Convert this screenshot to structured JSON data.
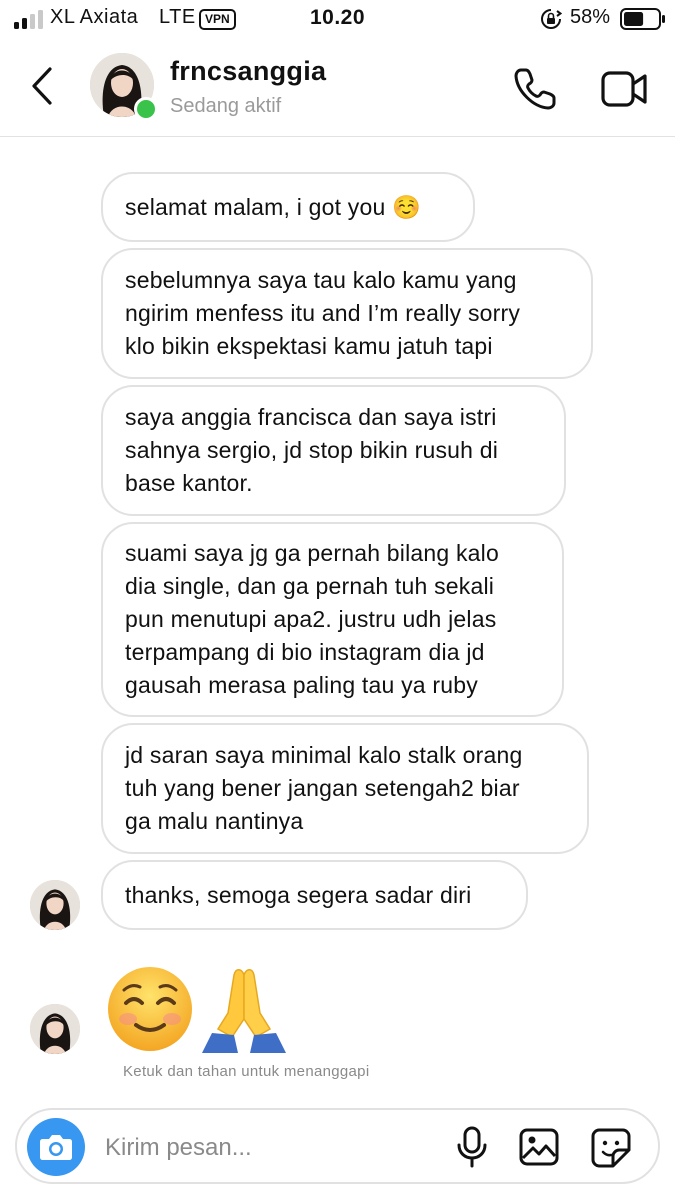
{
  "status_bar": {
    "carrier": "XL Axiata",
    "network": "LTE",
    "vpn": "VPN",
    "time": "10.20",
    "battery": "58%",
    "battery_level": 0.58,
    "signal_bars_filled": 2,
    "signal_bars_total": 4
  },
  "header": {
    "username": "frncsanggia",
    "activity": "Sedang aktif",
    "online_color": "#3ac34a",
    "icons": [
      "back-chevron-icon",
      "phone-icon",
      "video-camera-icon"
    ]
  },
  "messages": [
    {
      "text": "selamat malam, i got you ☺️"
    },
    {
      "text": "sebelumnya saya tau kalo kamu yang\nngirim menfess itu and I’m really sorry\nklo bikin ekspektasi kamu jatuh tapi"
    },
    {
      "text": "saya anggia francisca dan saya istri\nsahnya sergio, jd stop bikin rusuh di\nbase kantor."
    },
    {
      "text": "suami saya jg ga pernah bilang kalo\ndia single, dan ga pernah tuh sekali\npun menutupi apa2. justru udh jelas\nterpampang di bio instagram dia jd\ngausah merasa paling tau ya ruby"
    },
    {
      "text": "jd saran saya minimal kalo stalk orang\ntuh yang bener jangan setengah2 biar\nga malu nantinya"
    },
    {
      "text": "thanks, semoga segera sadar diri"
    }
  ],
  "emoji_message": {
    "emojis": [
      "smiling-face-icon",
      "folded-hands-icon"
    ],
    "hint": "Ketuk dan tahan untuk menanggapi"
  },
  "composer": {
    "placeholder": "Kirim pesan...",
    "camera_color": "#3897f0",
    "icons": [
      "camera-icon",
      "microphone-icon",
      "gallery-icon",
      "sticker-icon"
    ]
  }
}
